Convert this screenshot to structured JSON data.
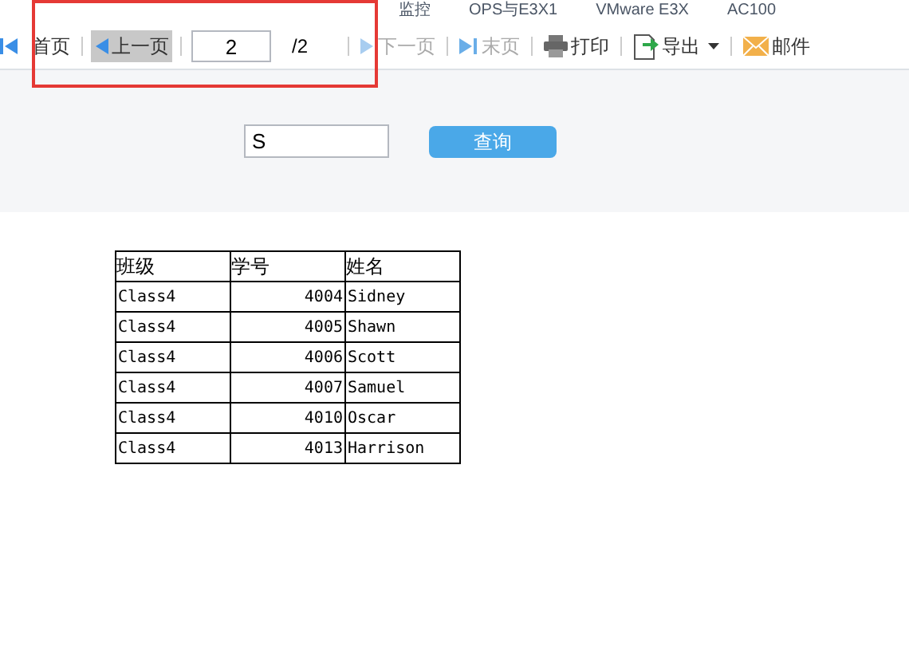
{
  "bookmarks": [
    {
      "label": "监控"
    },
    {
      "label": "OPS与E3X1"
    },
    {
      "label": "VMware E3X"
    },
    {
      "label": "AC100"
    }
  ],
  "toolbar": {
    "items": [
      {
        "kind": "first",
        "label": "首页",
        "disabled": false,
        "highlighted": false
      },
      {
        "kind": "prev",
        "label": "上一页",
        "disabled": false,
        "highlighted": true
      },
      {
        "kind": "page",
        "value": "2",
        "total": "/2"
      },
      {
        "kind": "next",
        "label": "下一页",
        "disabled": true,
        "highlighted": false
      },
      {
        "kind": "last",
        "label": "末页",
        "disabled": true,
        "highlighted": false
      },
      {
        "kind": "print",
        "label": "打印",
        "disabled": false,
        "highlighted": false
      },
      {
        "kind": "export",
        "label": "导出",
        "disabled": false,
        "highlighted": false
      },
      {
        "kind": "mail",
        "label": "邮件",
        "disabled": false,
        "highlighted": false
      }
    ]
  },
  "search": {
    "value": "S",
    "button": "查询"
  },
  "table": {
    "columns": [
      "班级",
      "学号",
      "姓名"
    ],
    "rows": [
      [
        "Class4",
        "4004",
        "Sidney"
      ],
      [
        "Class4",
        "4005",
        "Shawn"
      ],
      [
        "Class4",
        "4006",
        "Scott"
      ],
      [
        "Class4",
        "4007",
        "Samuel"
      ],
      [
        "Class4",
        "4010",
        "Oscar"
      ],
      [
        "Class4",
        "4013",
        "Harrison"
      ]
    ]
  }
}
